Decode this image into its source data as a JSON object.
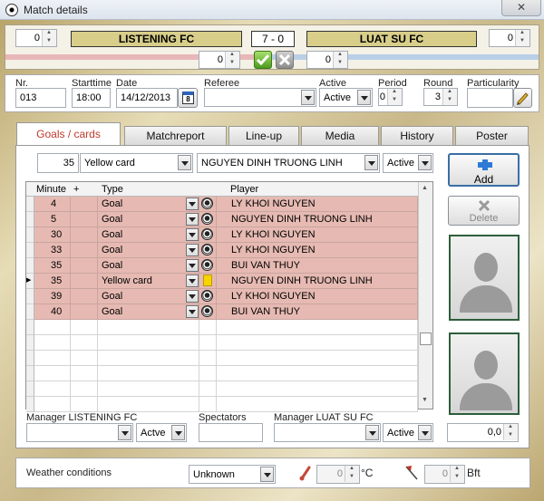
{
  "window": {
    "title": "Match details",
    "close_glyph": "✕"
  },
  "header": {
    "home_penalty": "0",
    "home_team": "LISTENING FC",
    "score": "7  -  0",
    "away_team": "LUAT SU FC",
    "away_penalty": "0",
    "home_extra": "0",
    "away_extra": "0"
  },
  "details": {
    "nr_label": "Nr.",
    "nr_value": "013",
    "starttime_label": "Starttime",
    "starttime_value": "18:00",
    "date_label": "Date",
    "date_value": "14/12/2013",
    "calendar_glyph": "8",
    "referee_label": "Referee",
    "referee_value": "",
    "active_label": "Active",
    "active_value": "Active",
    "period_label": "Period",
    "period_value": "0",
    "round_label": "Round",
    "round_value": "3",
    "particularity_label": "Particularity",
    "particularity_value": ""
  },
  "tabs": [
    "Goals / cards",
    "Matchreport",
    "Line-up",
    "Media",
    "History",
    "Poster"
  ],
  "entry": {
    "minute": "35",
    "type": "Yellow card",
    "player": "NGUYEN DINH TRUONG LINH",
    "status": "Active"
  },
  "grid": {
    "headers": {
      "minute": "Minute",
      "plus": "+",
      "type": "Type",
      "player": "Player"
    },
    "current_row_marker": "▶",
    "rows": [
      {
        "minute": "4",
        "type": "Goal",
        "icon": "football-icon",
        "player": "LY KHOI NGUYEN"
      },
      {
        "minute": "5",
        "type": "Goal",
        "icon": "football-icon",
        "player": "NGUYEN DINH TRUONG LINH"
      },
      {
        "minute": "30",
        "type": "Goal",
        "icon": "football-icon",
        "player": "LY KHOI NGUYEN"
      },
      {
        "minute": "33",
        "type": "Goal",
        "icon": "football-icon",
        "player": "LY KHOI NGUYEN"
      },
      {
        "minute": "35",
        "type": "Goal",
        "icon": "football-icon",
        "player": "BUI VAN THUY"
      },
      {
        "minute": "35",
        "type": "Yellow card",
        "icon": "yellow-card-icon",
        "player": "NGUYEN DINH TRUONG LINH"
      },
      {
        "minute": "39",
        "type": "Goal",
        "icon": "football-icon",
        "player": "LY KHOI NGUYEN"
      },
      {
        "minute": "40",
        "type": "Goal",
        "icon": "football-icon",
        "player": "BUI VAN THUY"
      }
    ]
  },
  "buttons": {
    "add": "Add",
    "delete": "Delete"
  },
  "bottom": {
    "manager_home_label": "Manager LISTENING FC",
    "manager_home_status": "Actve",
    "spectators_label": "Spectators",
    "spectators_value": "",
    "manager_away_label": "Manager LUAT SU FC",
    "manager_away_status": "Active",
    "rating_value": "0,0"
  },
  "weather": {
    "label": "Weather conditions",
    "condition": "Unknown",
    "temperature": "0",
    "temperature_unit": "°C",
    "wind": "0",
    "wind_unit": "Bft"
  },
  "colors": {
    "row_fill": "#e6bab2",
    "team_bar": "#d8ce8a",
    "active_tab_text": "#c0392b",
    "home_stripe": "#e8b7b7",
    "away_stripe": "#b9cfe8"
  }
}
